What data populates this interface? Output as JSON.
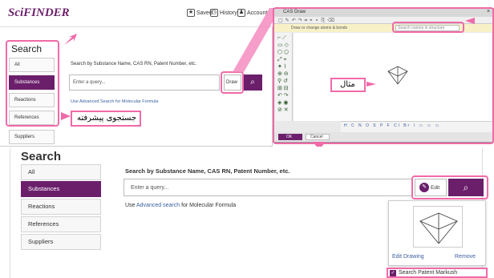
{
  "top": {
    "logo": "SciFINDER",
    "header": {
      "saved": "Saved",
      "history": "History",
      "account": "Account"
    },
    "search_title": "Search",
    "side": [
      "All",
      "Substances",
      "Reactions",
      "References",
      "Suppliers"
    ],
    "instruction": "Search by Substance Name, CAS RN, Patent Number, etc.",
    "query_placeholder": "Enter a query...",
    "draw_label": "Draw",
    "advanced": "Use Advanced Search for Molecular Formula",
    "advanced_label": "جستجوی پیشرفته"
  },
  "editor": {
    "title": "CAS Draw",
    "hint": "Draw or change atoms & bonds",
    "search_placeholder": "Search names in structure",
    "example_label": "مثال",
    "ok": "OK",
    "cancel": "Cancel"
  },
  "bottom": {
    "search_title": "Search",
    "side": [
      "All",
      "Substances",
      "Reactions",
      "References",
      "Suppliers"
    ],
    "instruction": "Search by Substance Name, CAS RN, Patent Number, etc.",
    "query_placeholder": "Enter a query...",
    "edit_label": "Edit",
    "advanced_prefix": "Use",
    "advanced_link": "Advanced search",
    "advanced_suffix": "for Molecular Formula",
    "edit_drawing": "Edit Drawing",
    "remove": "Remove",
    "markush": "Search Patent Markush"
  },
  "colors": {
    "accent": "#6b1f6b",
    "highlight": "#f06aa8"
  }
}
